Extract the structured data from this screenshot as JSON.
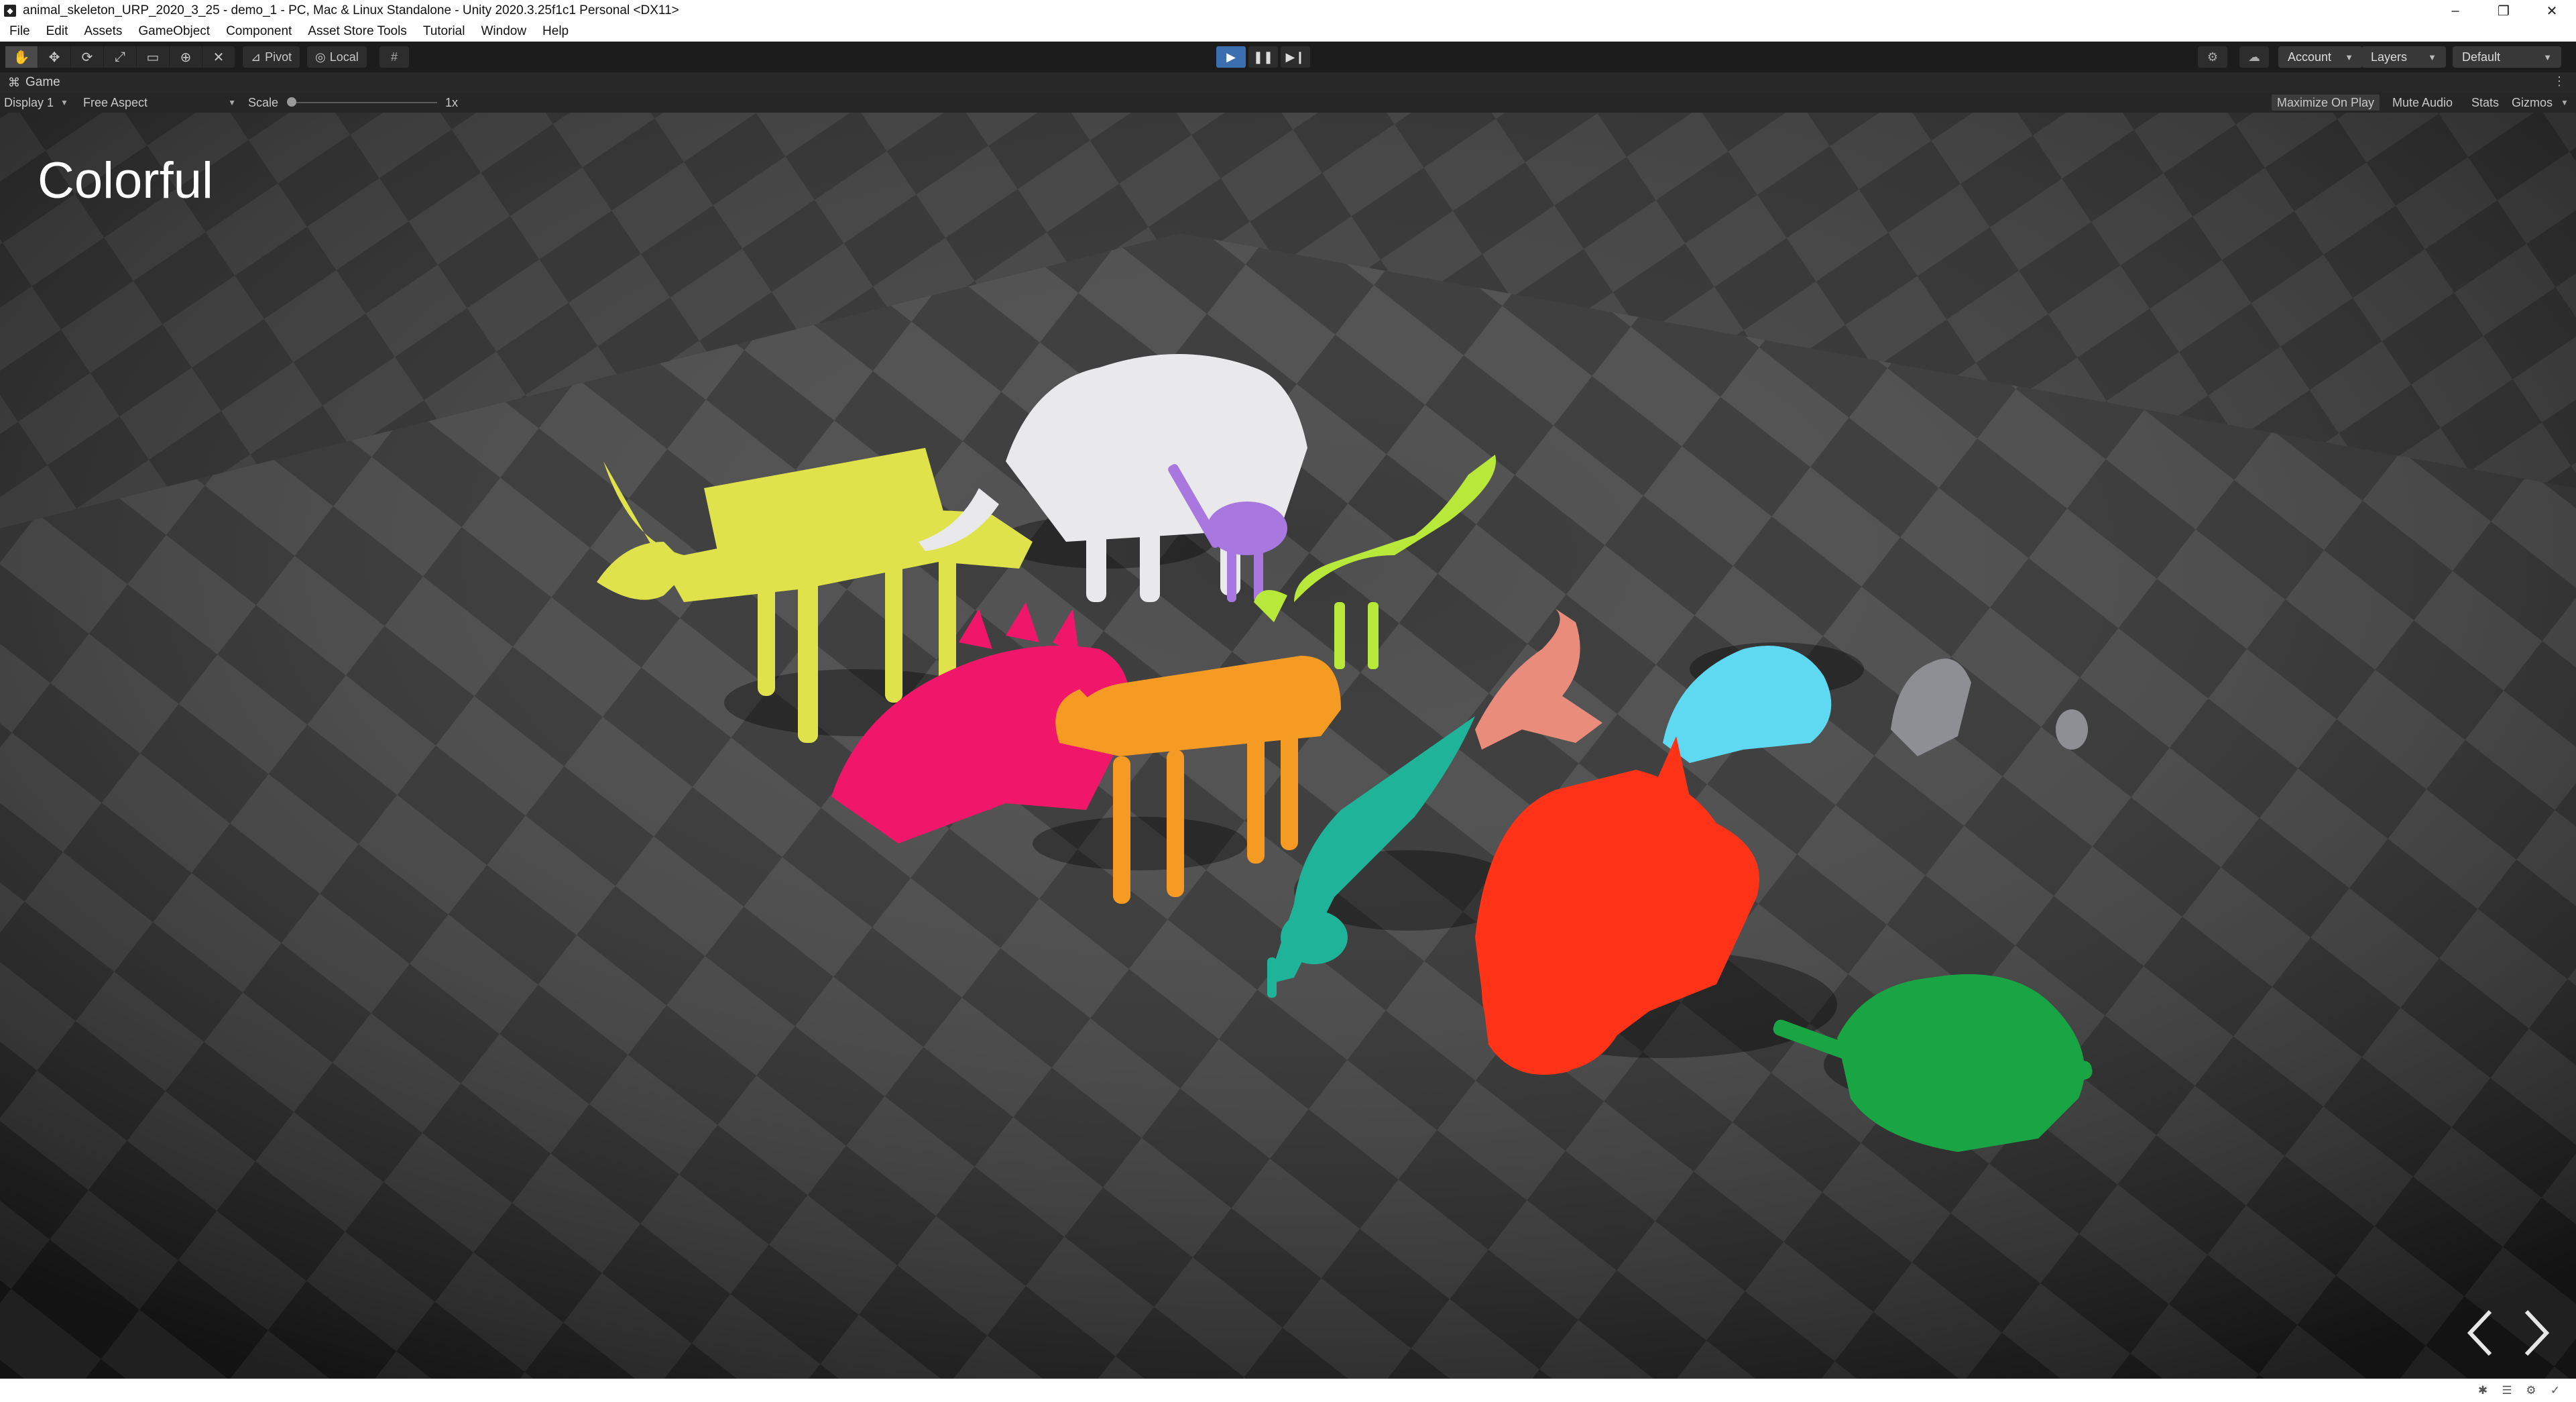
{
  "window": {
    "title": "animal_skeleton_URP_2020_3_25 - demo_1 - PC, Mac & Linux Standalone - Unity 2020.3.25f1c1 Personal <DX11>",
    "app_icon": "unity-icon",
    "controls": [
      "minimize-icon",
      "restore-icon",
      "close-icon"
    ]
  },
  "menu": {
    "items": [
      "File",
      "Edit",
      "Assets",
      "GameObject",
      "Component",
      "Asset Store Tools",
      "Tutorial",
      "Window",
      "Help"
    ]
  },
  "toolbar": {
    "tools": [
      "hand-tool-icon",
      "move-tool-icon",
      "rotate-tool-icon",
      "scale-tool-icon",
      "rect-tool-icon",
      "transform-tool-icon",
      "custom-tool-icon"
    ],
    "pivot_label": "Pivot",
    "local_label": "Local",
    "grid_icon": "grid-snap-icon",
    "play_icons": [
      "play-icon",
      "pause-icon",
      "step-icon"
    ],
    "account_label": "Account",
    "layers_label": "Layers",
    "layout_label": "Default"
  },
  "game_tab": {
    "label": "Game",
    "icon": "gamepad-icon"
  },
  "game_bar": {
    "display_label": "Display 1",
    "aspect_label": "Free Aspect",
    "scale_label": "Scale",
    "scale_value": "1x",
    "scale_fraction": 0.0,
    "maximize_label": "Maximize On Play",
    "mute_label": "Mute Audio",
    "stats_label": "Stats",
    "gizmos_label": "Gizmos"
  },
  "viewport": {
    "scene_label": "Colorful",
    "prev_icon": "chevron-left-icon",
    "next_icon": "chevron-right-icon",
    "skeleton_colors": {
      "yellow": "#dfe24a",
      "white": "#e9e9ec",
      "purple": "#a877e0",
      "lime": "#b7e83a",
      "pink": "#f0176a",
      "orange": "#f59b23",
      "salmon": "#ea8c7c",
      "cyan": "#5fd9f2",
      "teal": "#1fb39a",
      "red": "#ff3318",
      "green": "#1aa545",
      "gray": "#8d8f94"
    }
  },
  "status_icons": [
    "bug-icon",
    "list-icon",
    "settings-icon",
    "check-icon"
  ]
}
